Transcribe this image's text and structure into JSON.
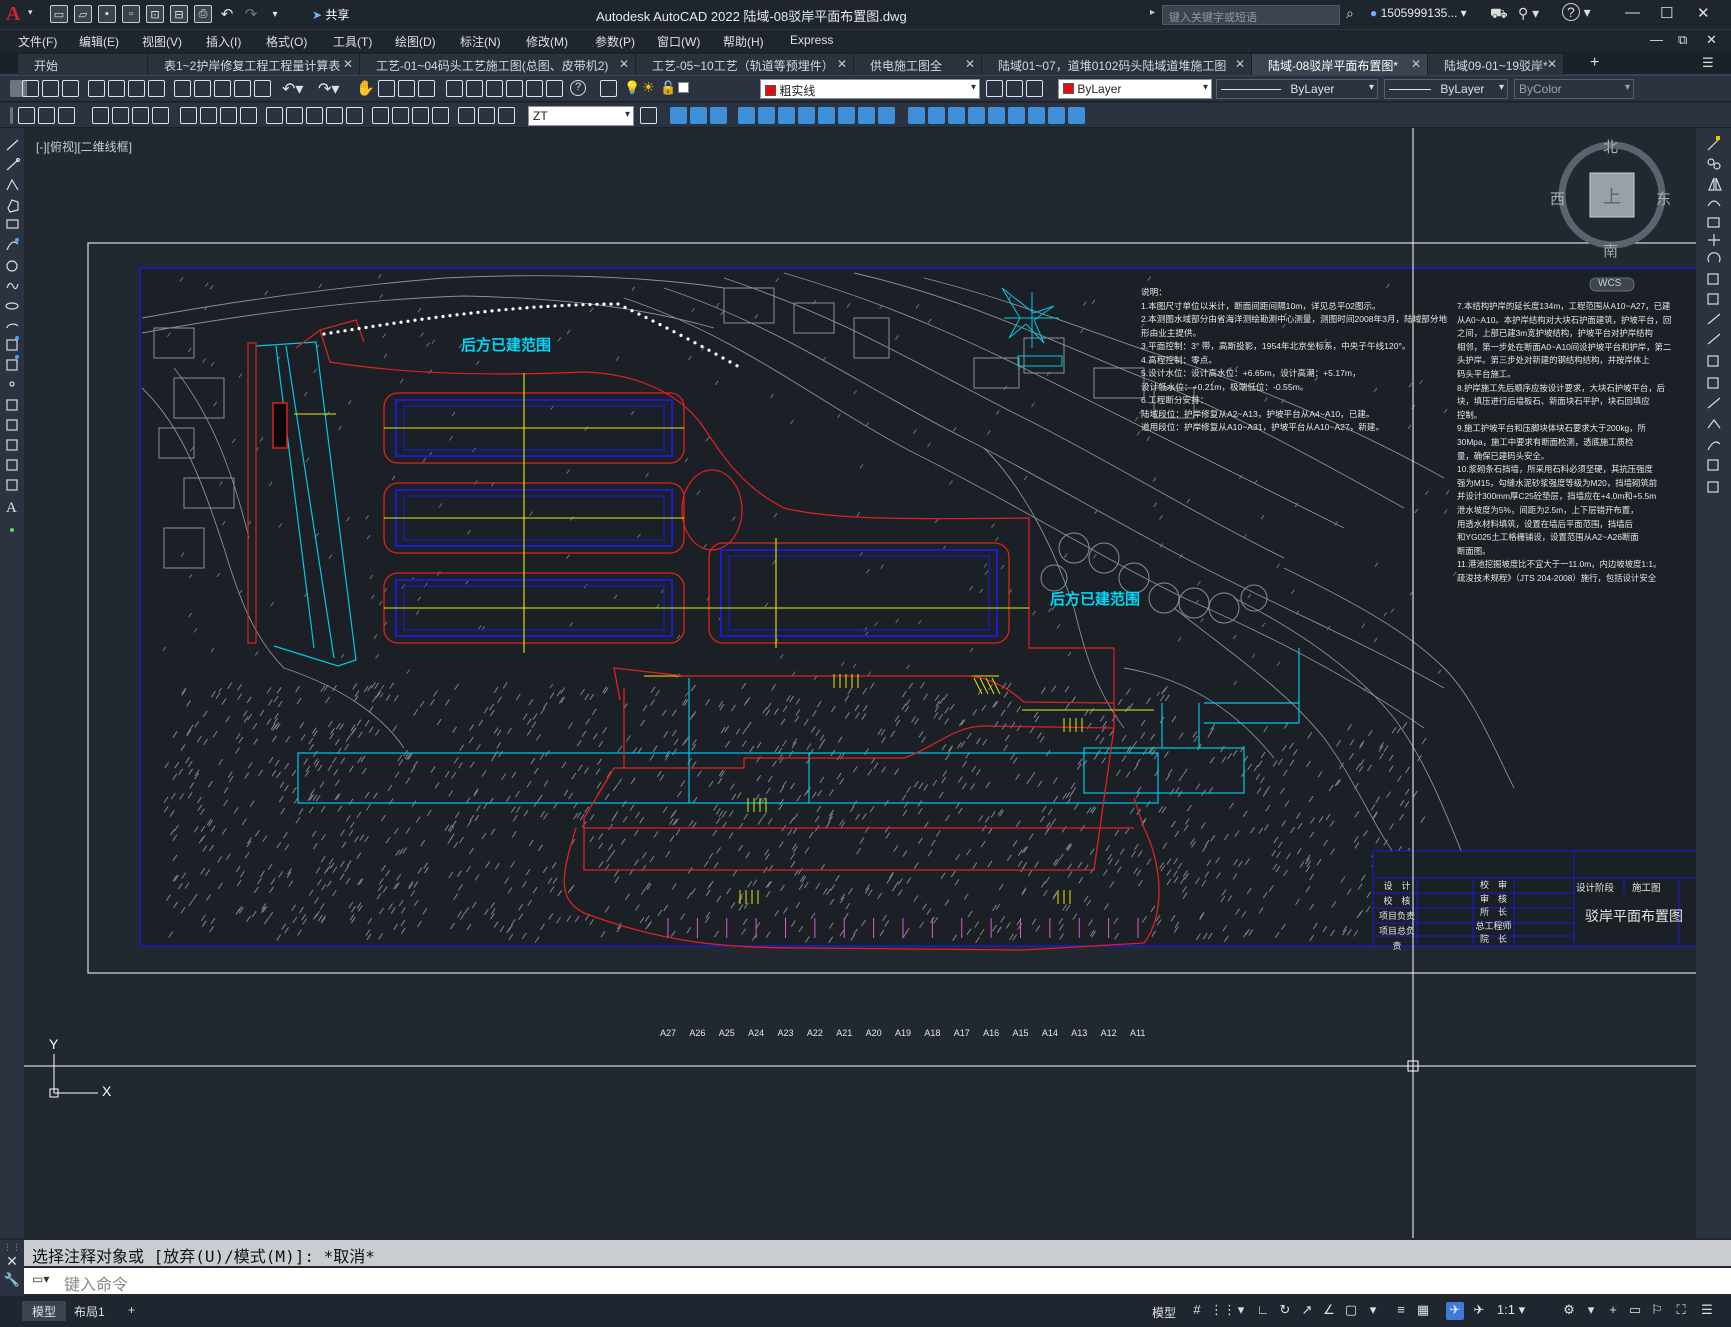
{
  "app": {
    "title": "Autodesk AutoCAD 2022    陆域-08驳岸平面布置图.dwg",
    "share_label": "共享",
    "search_placeholder": "键入关键字或短语",
    "user": "1505999135...",
    "help_icon": "?"
  },
  "menu": [
    "文件(F)",
    "编辑(E)",
    "视图(V)",
    "插入(I)",
    "格式(O)",
    "工具(T)",
    "绘图(D)",
    "标注(N)",
    "修改(M)",
    "参数(P)",
    "窗口(W)",
    "帮助(H)",
    "Express"
  ],
  "tabs": [
    {
      "label": "开始",
      "closable": false,
      "active": false
    },
    {
      "label": "表1~2护岸修复工程工程量计算表",
      "closable": true,
      "active": false
    },
    {
      "label": "工艺-01~04码头工艺施工图(总图、皮带机2)",
      "closable": true,
      "active": false
    },
    {
      "label": "工艺-05~10工艺（轨道等预埋件）",
      "closable": true,
      "active": false
    },
    {
      "label": "供电施工图全",
      "closable": true,
      "active": false
    },
    {
      "label": "陆域01~07，道堆0102码头陆域道堆施工图",
      "closable": true,
      "active": false
    },
    {
      "label": "陆域-08驳岸平面布置图*",
      "closable": true,
      "active": true
    },
    {
      "label": "陆域09-01~19驳岸*",
      "closable": true,
      "active": false
    }
  ],
  "toolbar": {
    "layer_name": "粗实线",
    "layer_color": "#e01010",
    "color_combo": "ByLayer",
    "linetype_combo": "ByLayer",
    "lineweight_combo": "ByLayer",
    "plotstyle_combo": "ByColor",
    "textstyle_combo": "ZT"
  },
  "viewport": {
    "label": "[-][俯视][二维线框]",
    "viewcube": {
      "north": "北",
      "south": "南",
      "east": "东",
      "west": "西",
      "top": "上",
      "wcs": "WCS"
    },
    "ucs": {
      "x": "X",
      "y": "Y"
    }
  },
  "drawing": {
    "labels": {
      "existing_area_1": "后方已建范围",
      "existing_area_2": "后方已建范围"
    },
    "notes_title": "说明：",
    "notes": [
      "1.本图尺寸单位以米计，断面间距间隔10m，详见总平02图示。",
      "2.本测图水域部分由省海洋测绘勘测中心测量，测图时间2008年3月，陆域部分地",
      "形由业主提供。",
      "3.平面控制：3° 带，高斯投影，1954年北京坐标系，中央子午线120°。",
      "4.高程控制：零点。",
      "5.设计水位：设计高水位：+6.65m，设计高潮：+5.17m，",
      "   设计低水位：+0.21m，极端低位：-0.55m。",
      "6.工程断分安排：",
      "   陆域段位：护岸修复从A2~A13，护坡平台从A4~A10，已建。",
      "   道用段位：护岸修复从A10~A31，护坡平台从A10~A27，新建。"
    ],
    "notes_right": [
      "7.本结构护岸的延长度134m，工程范围从A10~A27，已建",
      "从A0~A10。本护岸结构对大块石护面建筑，护坡平台，回",
      "之间，上部已建3m宽护坡结构，护坡平台对护岸结构",
      "相邻，第一步处在断面A0~A10间设护坡平台和护岸，第二",
      "头护岸。第三步处对新建的钢结构结构，并按岸体上",
      "码头平台施工。",
      "8.护岸施工先后顺序应按设计要求，大块石护坡平台，后",
      "块，填压进行后墙板石、新面块石平护，块石回填应",
      "控制。",
      "9.施工护坡平台和压脚块体块石要求大于200kg，所",
      "30Mpa，施工中要求有断面检测，透底施工质检",
      "量，确保已建码头安全。",
      "10.浆砌条石挡墙，所采用石料必须坚硬，其抗压强度",
      "强为M15，勾缝水泥砂浆强度等级为M20，挡墙砌筑前",
      "并设计300mm厚C25砼垫层，挡墙应在+4.0m和+5.5m",
      "泄水坡度为5%，间距为2.5m，上下层错开布置，",
      "用透水材料填筑，设置在墙后平面范围，挡墙后",
      "和YG025土工格栅铺设，设置范围从A2~A26断面",
      "断面图。",
      "11.港池挖掘坡度比不宜大于一11.0m，内边坡坡度1:1。",
      "疏浚技术规程》（JTS 204-2008）施行，包括设计安全"
    ],
    "section_ticks": [
      "A27",
      "A26",
      "A25",
      "A24",
      "A23",
      "A22",
      "A21",
      "A20",
      "A19",
      "A18",
      "A17",
      "A16",
      "A15",
      "A14",
      "A13",
      "A12",
      "A11"
    ],
    "title_block": {
      "left_rows": [
        "设　计",
        "校　核",
        "项目负责",
        "项目总负责"
      ],
      "mid_rows": [
        "校　审",
        "审　核",
        "所　长",
        "总工程师",
        "院　长"
      ],
      "stage_label": "设计阶段",
      "stage_value": "施工图",
      "drawing_title": "驳岸平面布置图"
    }
  },
  "command": {
    "history": "选择注释对象或 [放弃(U)/模式(M)]: *取消*",
    "placeholder": "键入命令"
  },
  "statusbar": {
    "layout_tabs": [
      "模型",
      "布局1"
    ],
    "add_tab": "+",
    "model_label": "模型",
    "scale": "1:1"
  }
}
